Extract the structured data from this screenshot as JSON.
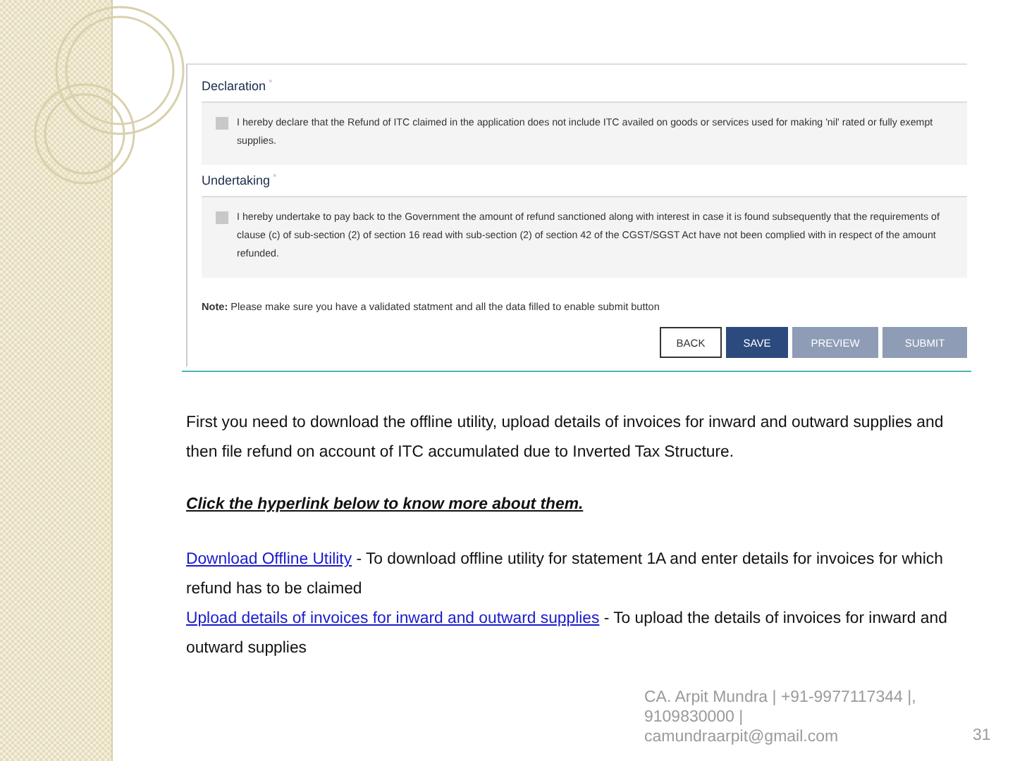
{
  "form": {
    "sections": [
      {
        "title": "Declaration",
        "required_mark": "*",
        "checked": false,
        "text": "I hereby declare that the Refund of ITC claimed in the application does not include ITC availed on goods or services used for making 'nil' rated or fully exempt supplies."
      },
      {
        "title": "Undertaking",
        "required_mark": "*",
        "checked": false,
        "text": "I hereby undertake to pay back to the Government the amount of refund sanctioned along with interest in case it is found subsequently that the requirements of clause (c) of sub-section (2) of section 16 read with sub-section (2) of section 42 of the CGST/SGST Act have not been complied with in respect of the amount refunded."
      }
    ],
    "note": "**Note:** Please make sure you have a validated statment and all the data filled to enable submit button",
    "buttons": [
      {
        "label": "BACK",
        "kind": "outline",
        "disabled": false
      },
      {
        "label": "SAVE",
        "kind": "primary",
        "disabled": false
      },
      {
        "label": "PREVIEW",
        "kind": "primary",
        "disabled": true
      },
      {
        "label": "SUBMIT",
        "kind": "primary",
        "disabled": true
      }
    ]
  },
  "body": {
    "intro": "First you need to download the offline utility, upload details of invoices for inward and outward supplies and then file refund on account of ITC accumulated due to Inverted Tax Structure.",
    "heading": "Click the hyperlink below to know more about them.",
    "links": [
      {
        "link": "Download Offline Utility",
        "description": " - To download offline utility for statement 1A and enter details for invoices for which refund has to be claimed"
      },
      {
        "link": "Upload details of invoices for inward and outward supplies",
        "description": " - To upload the details of invoices for inward and outward supplies"
      }
    ]
  },
  "footer": {
    "lines": [
      "CA. Arpit Mundra | +91-9977117344 |,",
      "9109830000 |",
      "camundraarpit@gmail.com"
    ],
    "page_number": "31"
  }
}
